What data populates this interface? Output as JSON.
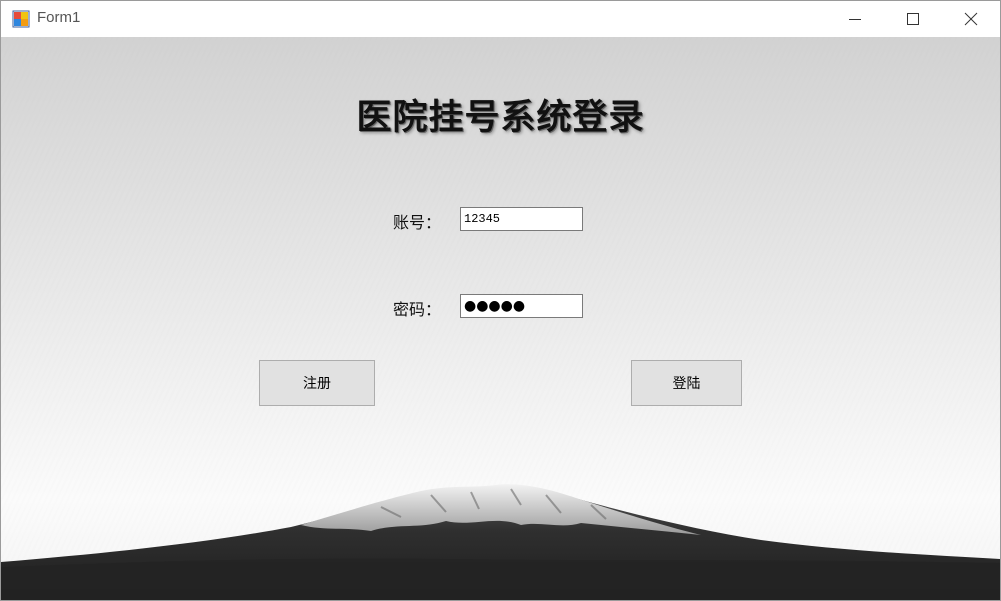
{
  "window": {
    "title": "Form1",
    "icon": "winforms-app-icon",
    "controls": [
      "minimize-icon",
      "maximize-icon",
      "close-icon"
    ]
  },
  "form": {
    "heading": "医院挂号系统登录",
    "account_label": "账号：",
    "account_value": "12345",
    "password_label": "密码：",
    "password_masked": "●●●●●",
    "register_label": "注册",
    "login_label": "登陆"
  },
  "background": {
    "description_icon": "snow-mountain-landscape"
  }
}
